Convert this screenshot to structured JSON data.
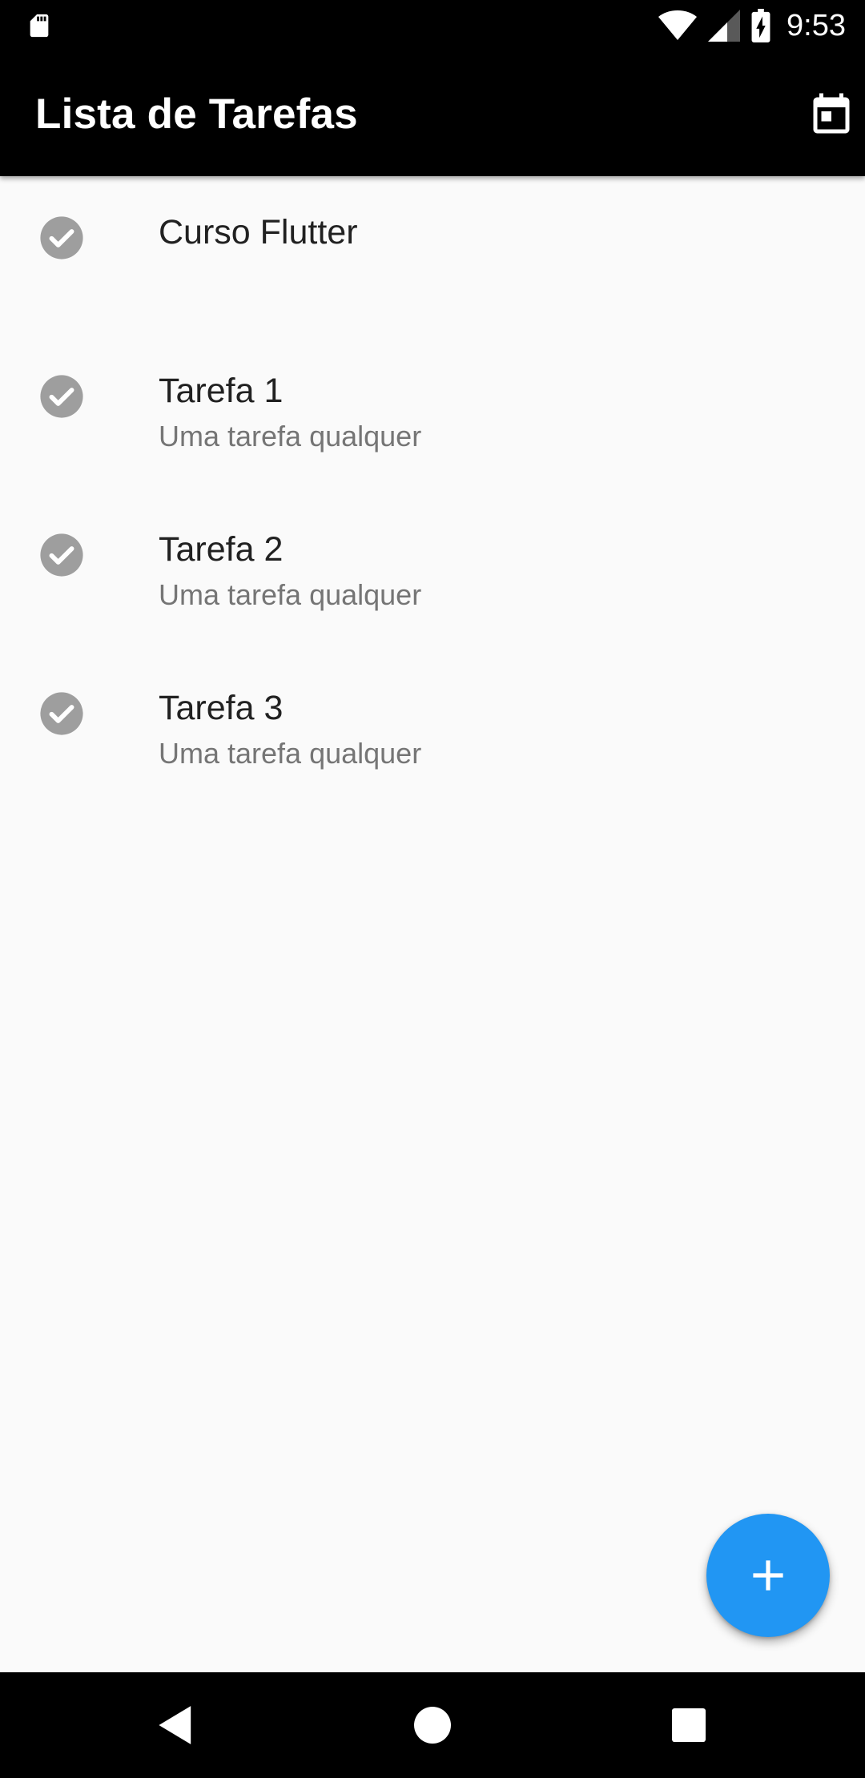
{
  "status_bar": {
    "time": "9:53",
    "icons": [
      "sd-card-icon",
      "wifi-icon",
      "cell-signal-icon",
      "battery-charging-icon"
    ]
  },
  "app_bar": {
    "title": "Lista de Tarefas",
    "action_icon": "calendar-icon"
  },
  "tasks": [
    {
      "title": "Curso Flutter",
      "subtitle": "",
      "done": true
    },
    {
      "title": "Tarefa 1",
      "subtitle": "Uma tarefa qualquer",
      "done": true
    },
    {
      "title": "Tarefa 2",
      "subtitle": "Uma tarefa qualquer",
      "done": true
    },
    {
      "title": "Tarefa 3",
      "subtitle": "Uma tarefa qualquer",
      "done": true
    }
  ],
  "fab": {
    "icon": "add-icon"
  },
  "nav_bar": {
    "icons": [
      "back-icon",
      "home-icon",
      "recents-icon"
    ]
  },
  "colors": {
    "app_bar": "#000000",
    "background": "#fafafa",
    "fab": "#2196f3",
    "check_icon": "#9e9e9e",
    "title_text": "#212121",
    "subtitle_text": "#757575"
  }
}
